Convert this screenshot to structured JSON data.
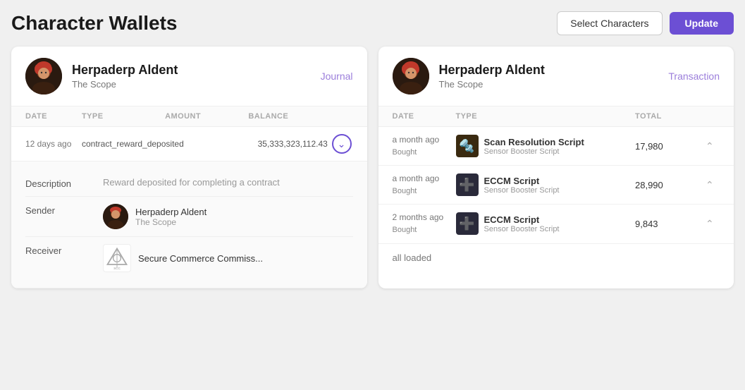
{
  "header": {
    "title": "Character Wallets",
    "select_label": "Select Characters",
    "update_label": "Update"
  },
  "left_panel": {
    "character": {
      "name": "Herpaderp Aldent",
      "corp": "The Scope"
    },
    "tab": "Journal",
    "table": {
      "columns": [
        "DATE",
        "TYPE",
        "AMOUNT",
        "BALANCE",
        ""
      ],
      "rows": [
        {
          "date": "12 days ago",
          "type": "contract_reward_deposited",
          "amount": "",
          "balance": "35,333,323,112.43",
          "expanded": true
        }
      ]
    },
    "detail": {
      "description_label": "Description",
      "description_value": "Reward deposited for completing a contract",
      "sender_label": "Sender",
      "sender_name": "Herpaderp Aldent",
      "sender_corp": "The Scope",
      "receiver_label": "Receiver",
      "receiver_name": "Secure Commerce Commiss..."
    }
  },
  "right_panel": {
    "character": {
      "name": "Herpaderp Aldent",
      "corp": "The Scope"
    },
    "tab": "Transaction",
    "table": {
      "columns": [
        "DATE",
        "TYPE",
        "TOTAL",
        ""
      ],
      "rows": [
        {
          "date": "a month ago",
          "action": "Bought",
          "item_name": "Scan Resolution Script",
          "item_sub": "Sensor Booster Script",
          "total": "17,980",
          "icon": "🔩"
        },
        {
          "date": "a month ago",
          "action": "Bought",
          "item_name": "ECCM Script",
          "item_sub": "Sensor Booster Script",
          "total": "28,990",
          "icon": "➕"
        },
        {
          "date": "2 months ago",
          "action": "Bought",
          "item_name": "ECCM Script",
          "item_sub": "Sensor Booster Script",
          "total": "9,843",
          "icon": "➕"
        }
      ]
    },
    "footer": "all loaded"
  }
}
